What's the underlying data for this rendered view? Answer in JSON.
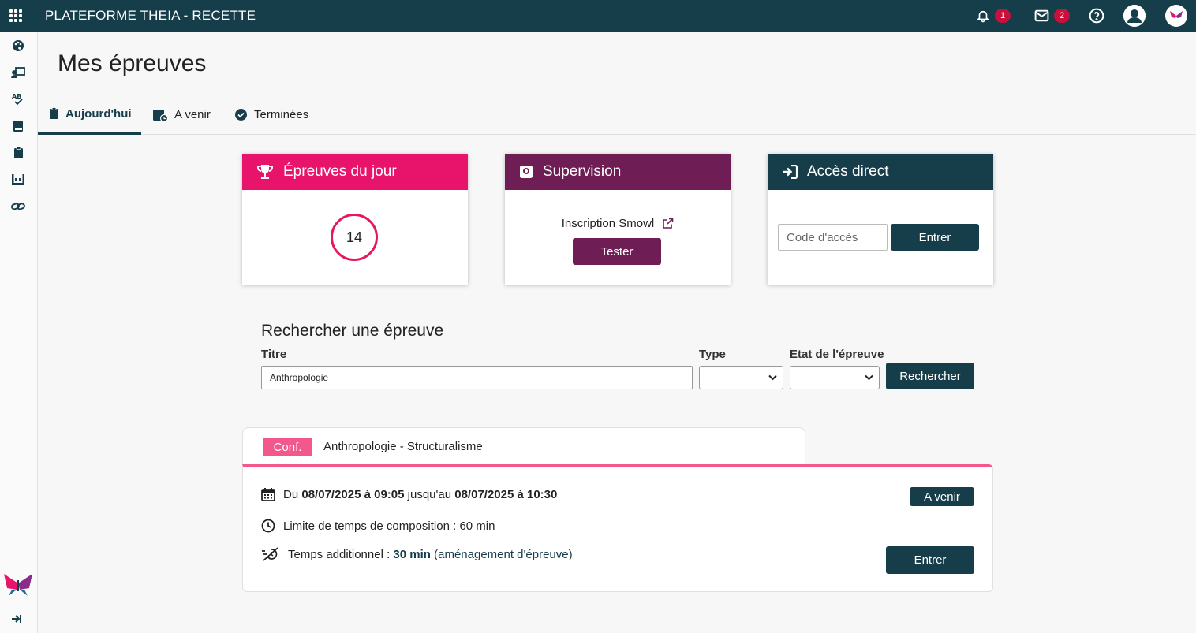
{
  "header": {
    "title": "PLATEFORME THEIA - RECETTE",
    "notifications_count": "1",
    "messages_count": "2"
  },
  "sidebar": {
    "items": [
      "palette-icon",
      "presentation-icon",
      "spellcheck-icon",
      "book-icon",
      "clipboard-icon",
      "calendar-grid-icon",
      "link-icon"
    ]
  },
  "page": {
    "title": "Mes épreuves"
  },
  "tabs": [
    {
      "label": "Aujourd'hui",
      "icon": "clipboard-icon",
      "active": true
    },
    {
      "label": "A venir",
      "icon": "calendar-clock-icon",
      "active": false
    },
    {
      "label": "Terminées",
      "icon": "check-badge-icon",
      "active": false
    }
  ],
  "cards": {
    "today": {
      "title": "Épreuves du jour",
      "count": "14",
      "color": "#e8146b"
    },
    "supervision": {
      "title": "Supervision",
      "link_label": "Inscription Smowl",
      "button_label": "Tester",
      "color": "#6e1d55"
    },
    "direct": {
      "title": "Accès direct",
      "placeholder": "Code d'accès",
      "button_label": "Entrer",
      "color": "#163d4a"
    }
  },
  "search": {
    "title": "Rechercher une épreuve",
    "title_label": "Titre",
    "title_value": "Anthropologie",
    "type_label": "Type",
    "state_label": "Etat de l'épreuve",
    "button_label": "Rechercher"
  },
  "result": {
    "badge": "Conf.",
    "name": "Anthropologie - Structuralisme",
    "date_prefix": "Du",
    "date_start": "08/07/2025 à 09:05",
    "date_mid": "jusqu'au",
    "date_end": "08/07/2025 à 10:30",
    "status": "A venir",
    "time_limit": "Limite de temps de composition : 60 min",
    "extra_prefix": "Temps additionnel :",
    "extra_value": "30 min",
    "extra_note": "(aménagement d'épreuve)",
    "button_label": "Entrer"
  }
}
